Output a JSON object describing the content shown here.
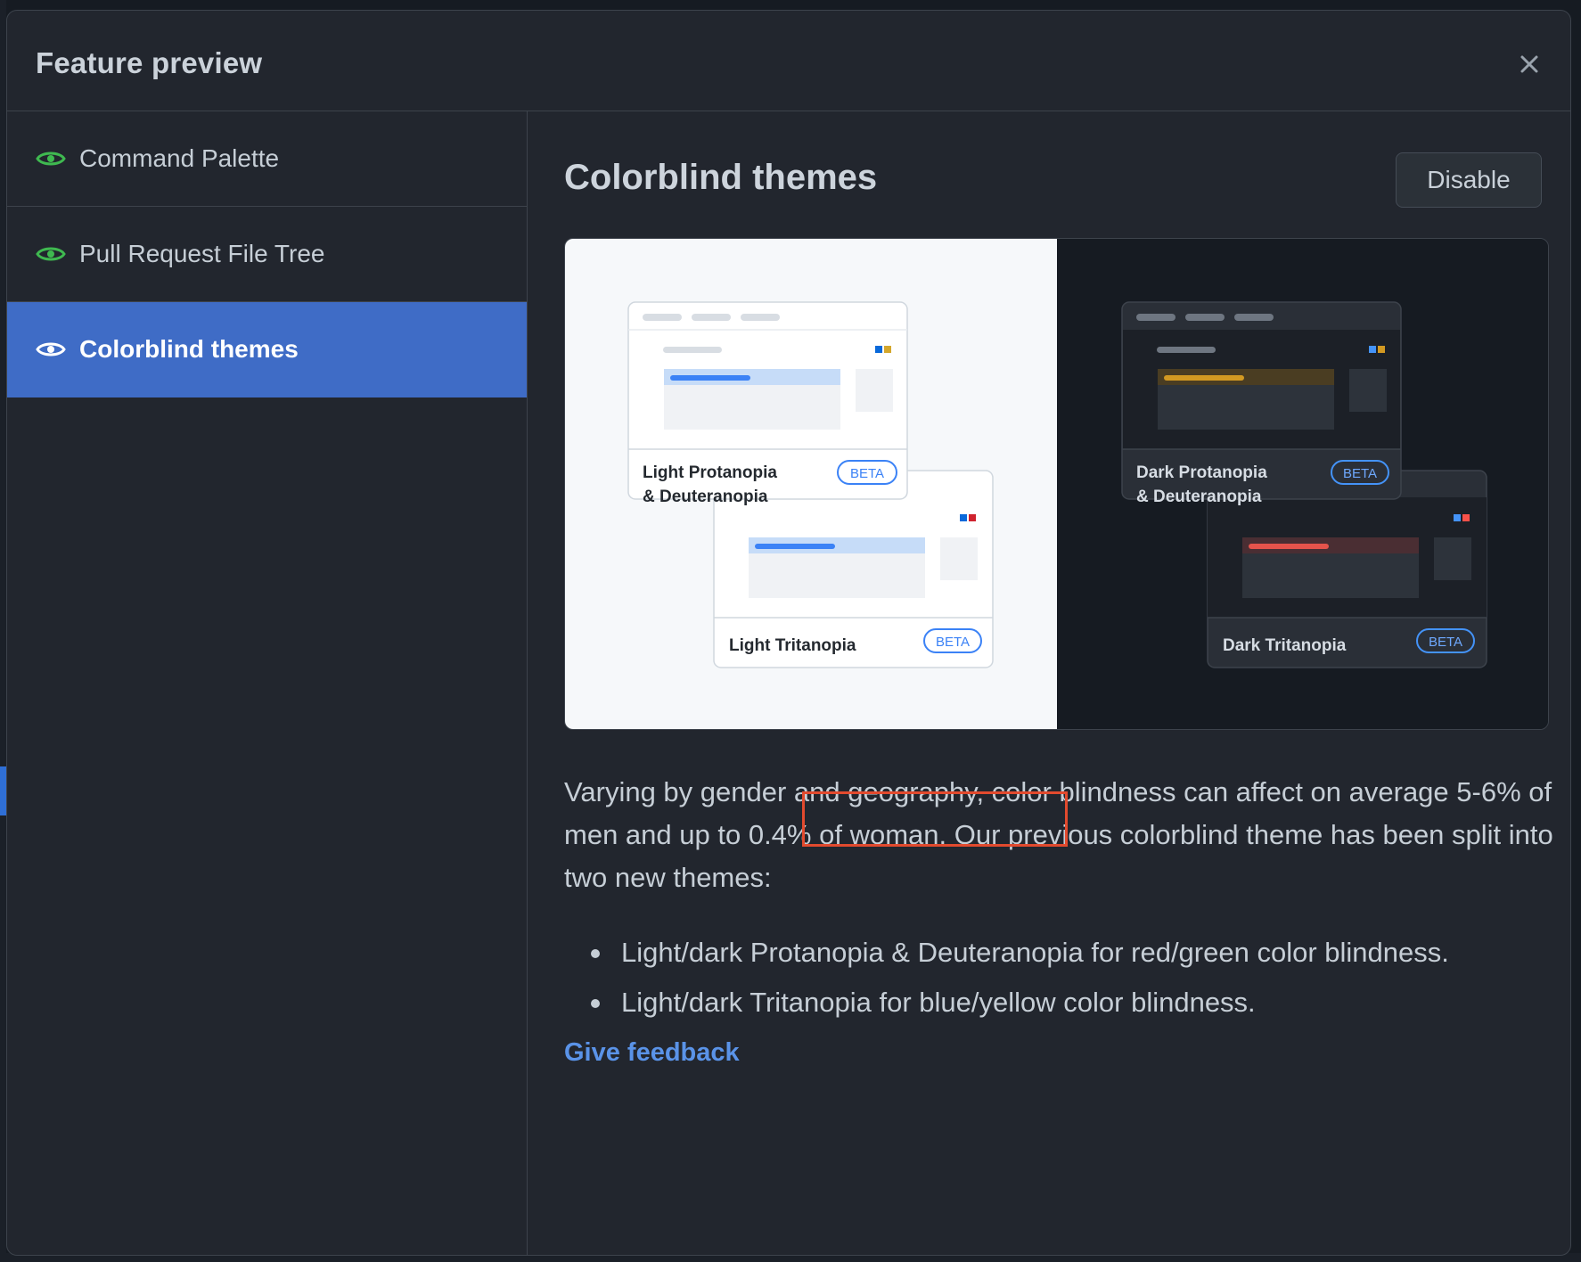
{
  "dialog": {
    "title": "Feature preview",
    "close_icon": "close-icon"
  },
  "sidebar": {
    "items": [
      {
        "label": "Command Palette",
        "icon": "eye-icon",
        "active": false
      },
      {
        "label": "Pull Request File Tree",
        "icon": "eye-icon",
        "active": false
      },
      {
        "label": "Colorblind themes",
        "icon": "eye-icon",
        "active": true
      }
    ]
  },
  "content": {
    "title": "Colorblind themes",
    "disable_label": "Disable",
    "preview": {
      "light_cards": [
        {
          "label_line1": "Light Protanopia",
          "label_line2": "& Deuteranopia",
          "badge": "BETA"
        },
        {
          "label_line1": "Light Tritanopia",
          "label_line2": "",
          "badge": "BETA"
        }
      ],
      "dark_cards": [
        {
          "label_line1": "Dark Protanopia",
          "label_line2": "& Deuteranopia",
          "badge": "BETA"
        },
        {
          "label_line1": "Dark Tritanopia",
          "label_line2": "",
          "badge": "BETA"
        }
      ]
    },
    "description_before": "Varying by gender and geography, color blindness can affect on average 5-6% of men and up ",
    "description_highlight": "to 0.4% of woman.",
    "description_after": " Our previous colorblind theme has been split into two new themes:",
    "bullets": [
      "Light/dark Protanopia & Deuteranopia for red/green color blindness.",
      "Light/dark Tritanopia for blue/yellow color blindness."
    ],
    "feedback_link": "Give feedback"
  },
  "colors": {
    "accent_active": "#3f6cc6",
    "eye_green": "#3fb950",
    "link_blue": "#5a93e8",
    "highlight_red": "#e24a2e"
  }
}
